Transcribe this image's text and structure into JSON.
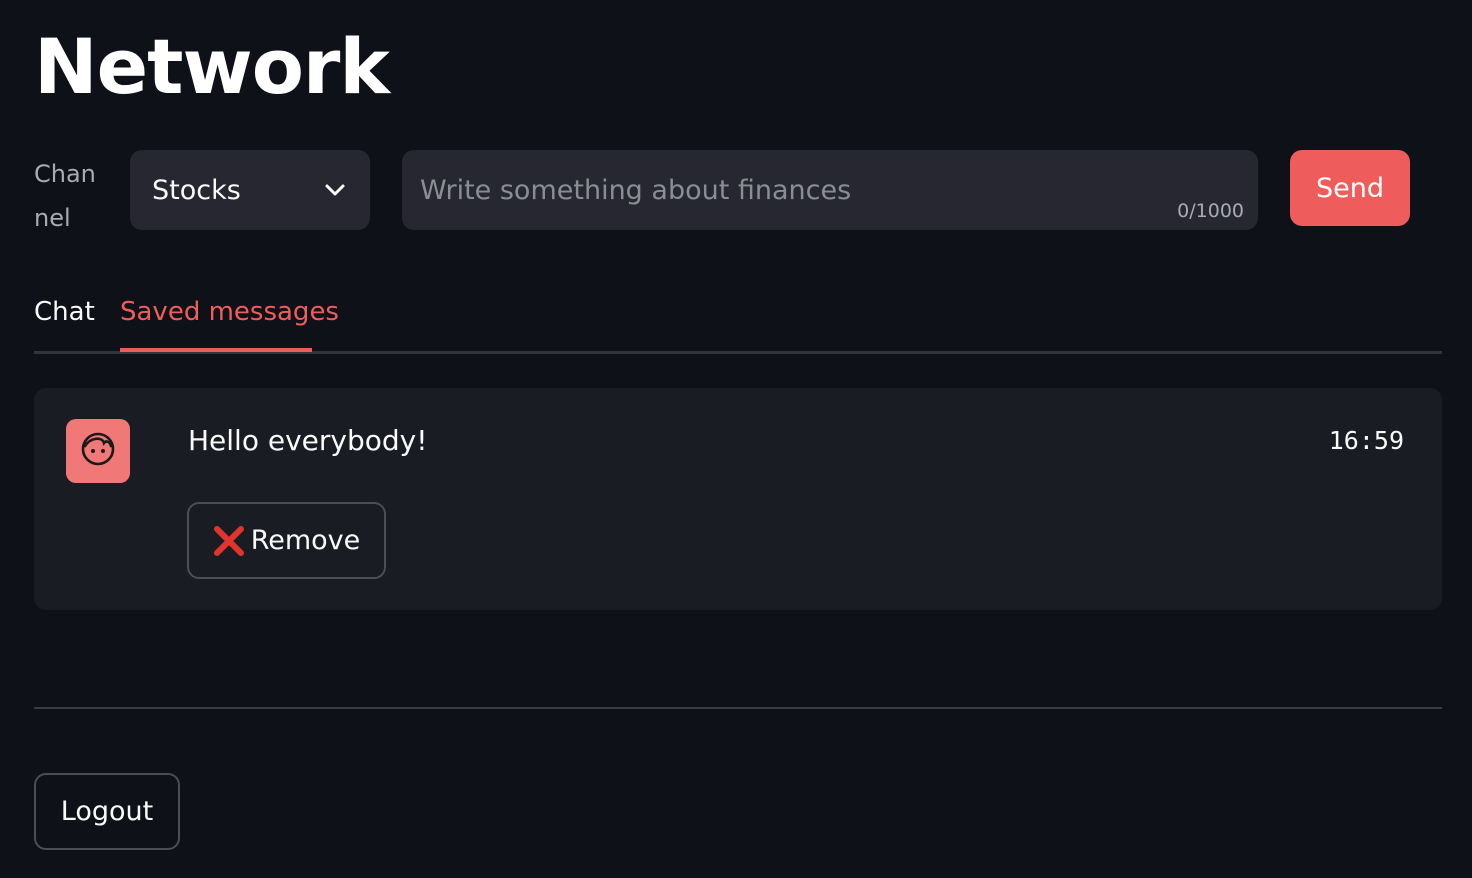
{
  "page": {
    "title": "Network"
  },
  "composer": {
    "channel_label": "Channel",
    "channel_value": "Stocks",
    "message_placeholder": "Write something about finances",
    "message_value": "",
    "char_counter": "0/1000",
    "send_label": "Send"
  },
  "tabs": [
    {
      "label": "Chat",
      "active": false
    },
    {
      "label": "Saved messages",
      "active": true
    }
  ],
  "saved_messages": [
    {
      "avatar_icon": "face-icon",
      "text": "Hello everybody!",
      "time": "16:59",
      "remove_label": "Remove",
      "remove_icon": "red-x-icon"
    }
  ],
  "footer": {
    "logout_label": "Logout"
  },
  "colors": {
    "background": "#0e1117",
    "accent": "#ee5d5b",
    "avatar": "#f07876",
    "input_bg": "#262730",
    "card_bg": "#1a1c24"
  }
}
